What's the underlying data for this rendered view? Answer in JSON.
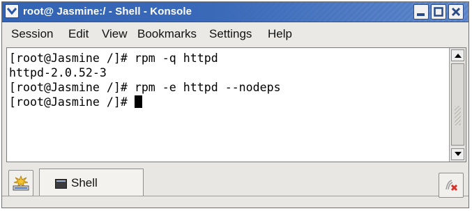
{
  "window": {
    "title": "root@ Jasmine:/ - Shell - Konsole",
    "colors": {
      "titlebar": "#3a69b8",
      "close_x": "#2a4b86"
    }
  },
  "menubar": {
    "items": [
      "Session",
      "Edit",
      "View",
      "Bookmarks",
      "Settings",
      "Help"
    ]
  },
  "terminal": {
    "lines": [
      "[root@Jasmine /]# rpm -q httpd",
      "httpd-2.0.52-3",
      "[root@Jasmine /]# rpm -e httpd --nodeps",
      "[root@Jasmine /]# "
    ]
  },
  "tabs": [
    {
      "label": "Shell",
      "icon": "terminal-icon"
    }
  ],
  "icons": {
    "window_menu": "chevron-down-icon",
    "new_session": "new-session-icon",
    "close_session": "close-session-icon"
  }
}
